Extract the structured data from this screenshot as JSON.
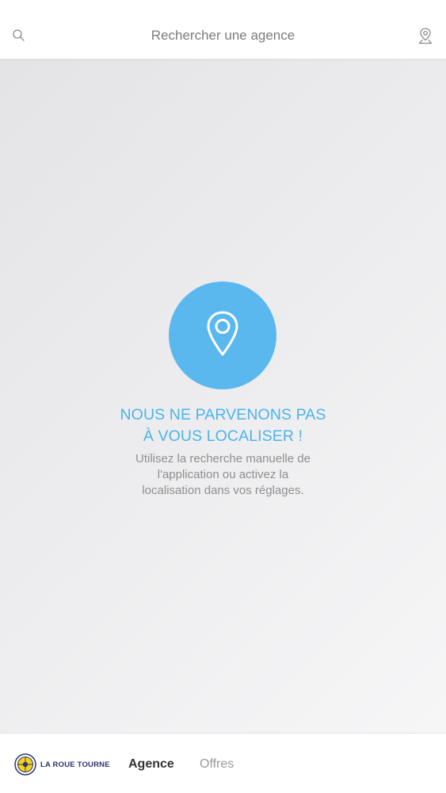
{
  "header": {
    "search_placeholder": "Rechercher une agence",
    "left_icon": "search-icon",
    "right_icon": "location-pin-icon"
  },
  "empty_state": {
    "icon": "location-pin-icon",
    "title_line1": "NOUS NE PARVENONS PAS",
    "title_line2": "À VOUS LOCALISER !",
    "desc_line1": "Utilisez la recherche manuelle de",
    "desc_line2": "l'application ou activez la",
    "desc_line3": "localisation dans vos réglages.",
    "accent_color": "#5ab8ef"
  },
  "footer": {
    "logo_text": "LA ROUE TOURNE",
    "tabs": [
      {
        "label": "Agence",
        "active": true
      },
      {
        "label": "Offres",
        "active": false
      }
    ]
  }
}
